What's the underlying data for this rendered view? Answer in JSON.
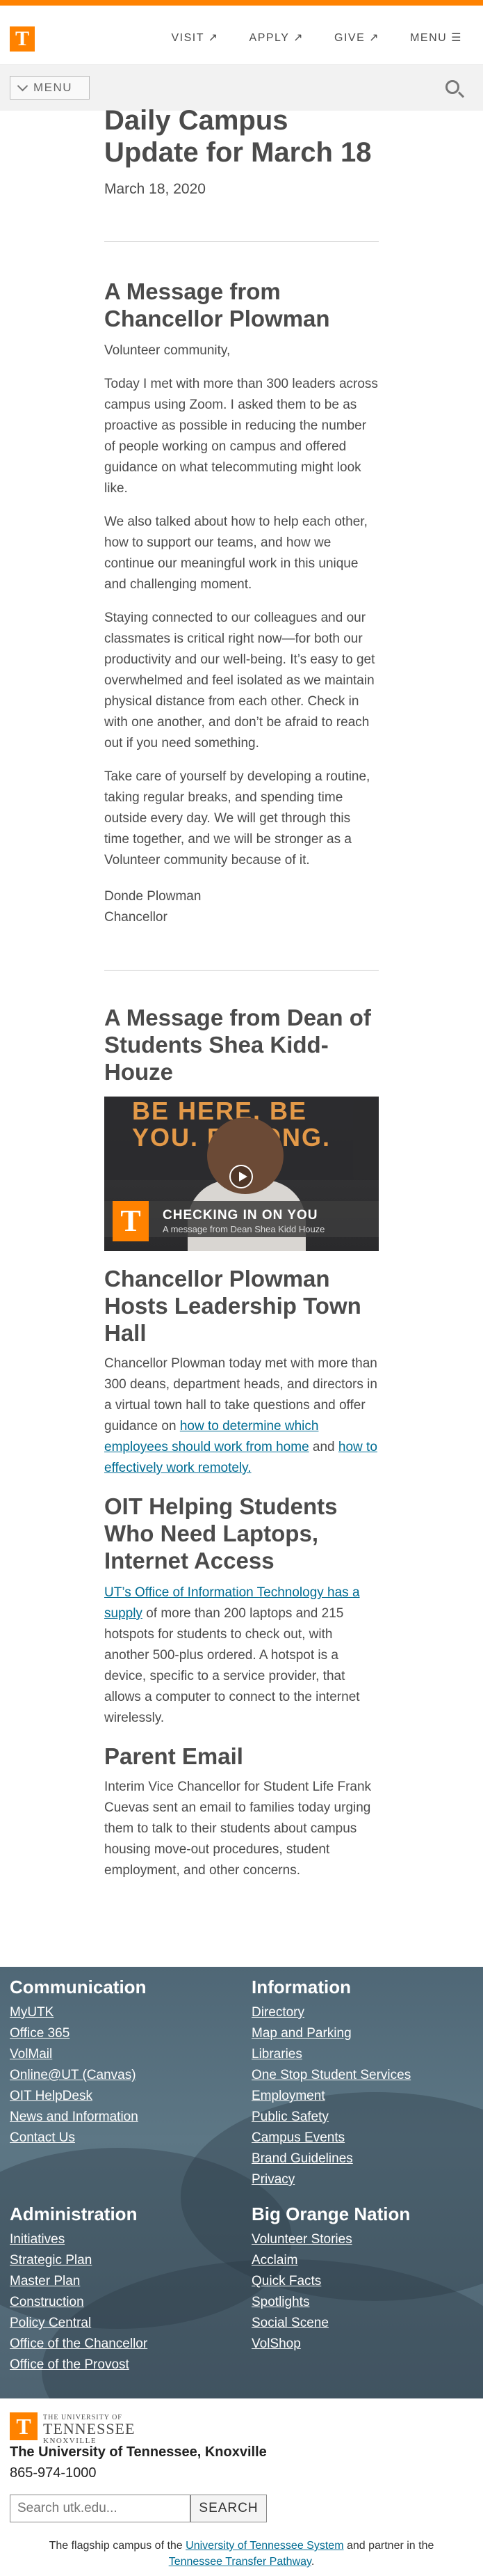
{
  "header": {
    "logo": "T",
    "nav": [
      {
        "label": "VISIT ↗"
      },
      {
        "label": "APPLY ↗"
      },
      {
        "label": "GIVE ↗"
      },
      {
        "label": "MENU ☰"
      }
    ],
    "menu_label": "MENU",
    "colors": {
      "orange": "#ff8200",
      "smokey": "#4b4b4b",
      "link": "#006c93"
    }
  },
  "article": {
    "title": "Daily Campus Update for March 18",
    "date": "March 18, 2020",
    "chancellor": {
      "heading": "A Message from Chancellor Plowman",
      "greeting": "Volunteer community,",
      "p1": "Today I met with more than 300 leaders across campus using Zoom. I asked them to be as proactive as possible in reducing the number of people working on campus and offered guidance on what telecommuting might look like.",
      "p2": "We also talked about how to help each other, how to support our teams, and how we continue our meaningful work in this unique and challenging moment.",
      "p3": "Staying connected to our colleagues and our classmates is critical right now—for both our productivity and our well-being. It’s easy to get overwhelmed and feel isolated as we maintain physical distance from each other. Check in with one another, and don’t be afraid to reach out if you need something.",
      "p4": "Take care of yourself by developing a routine, taking regular breaks, and spending time outside every day. We will get through this time together, and we will be stronger as a Volunteer community because of it.",
      "signature_name": "Donde Plowman",
      "signature_title": "Chancellor"
    },
    "dean": {
      "heading": "A Message from Dean of Students Shea Kidd-Houze",
      "video_wall_text": "BE HERE. BE YOU. BELONG.",
      "video_logo": "T",
      "video_title": "CHECKING IN ON YOU",
      "video_subtitle": "A message from Dean Shea Kidd Houze"
    },
    "townhall": {
      "heading": "Chancellor Plowman Hosts Leadership Town Hall",
      "text_before": "Chancellor Plowman today met with more than 300 deans, department heads, and directors in a virtual town hall to take questions and offer guidance on ",
      "link1": "how to determine which employees should work from home",
      "text_middle": " and ",
      "link2": "how to effectively work remotely."
    },
    "oit": {
      "heading": "OIT Helping Students Who Need Laptops, Internet Access",
      "link": "UT’s Office of Information Technology has a supply",
      "text": " of more than 200 laptops and 215 hotspots for students to check out, with another 500-plus ordered. A hotspot is a device, specific to a service provider, that allows a computer to connect to the internet wirelessly."
    },
    "parent": {
      "heading": "Parent Email",
      "text": "Interim Vice Chancellor for Student Life Frank Cuevas sent an email to families today urging them to talk to their students about campus housing move-out procedures, student employment, and other concerns."
    }
  },
  "footer": {
    "communication": {
      "heading": "Communication",
      "links": [
        "MyUTK",
        "Office 365",
        "VolMail",
        "Online@UT (Canvas)",
        "OIT HelpDesk",
        "News and Information",
        "Contact Us"
      ]
    },
    "information": {
      "heading": "Information",
      "links": [
        "Directory",
        "Map and Parking",
        "Libraries",
        "One Stop Student Services",
        "Employment",
        "Public Safety",
        "Campus Events",
        "Brand Guidelines",
        "Privacy"
      ]
    },
    "administration": {
      "heading": "Administration",
      "links": [
        "Initiatives",
        "Strategic Plan",
        "Master Plan",
        "Construction",
        "Policy Central",
        "Office of the Chancellor",
        "Office of the Provost"
      ]
    },
    "big_orange": {
      "heading": "Big Orange Nation",
      "links": [
        "Volunteer Stories",
        "Acclaim",
        "Quick Facts",
        "Spotlights",
        "Social Scene",
        "VolShop"
      ]
    }
  },
  "bottom": {
    "logo_small": "THE UNIVERSITY OF",
    "logo_big": "TENNESSEE",
    "logo_city": "KNOXVILLE",
    "full_name": "The University of Tennessee, Knoxville",
    "phone": "865-974-1000",
    "search_placeholder": "Search utk.edu...",
    "search_button": "SEARCH",
    "flagship_1": "The flagship campus of the ",
    "flagship_link1": "University of Tennessee System",
    "flagship_2": " and partner in the ",
    "flagship_link2": "Tennessee Transfer Pathway",
    "flagship_3": "."
  }
}
